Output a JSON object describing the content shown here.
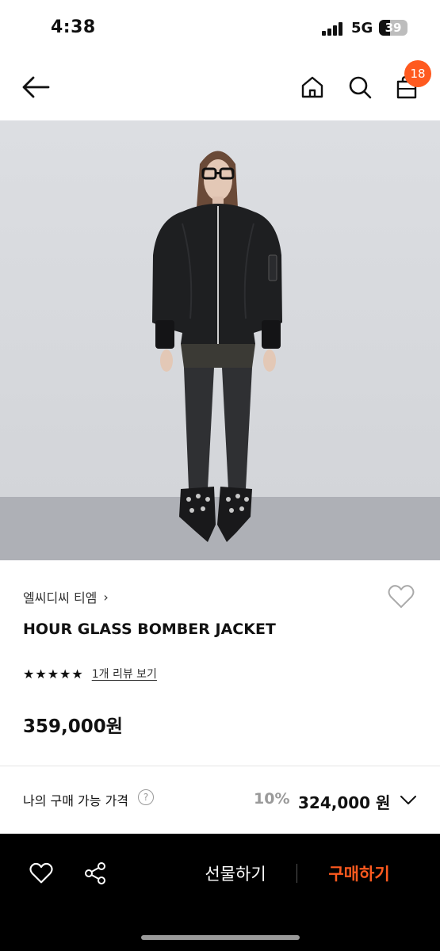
{
  "status_bar": {
    "time": "4:38",
    "network": "5G",
    "battery_level": "39"
  },
  "nav": {
    "back_icon": "arrow-left-icon",
    "home_icon": "home-icon",
    "search_icon": "search-icon",
    "cart_icon": "shopping-bag-icon",
    "cart_count": "18"
  },
  "product": {
    "brand": "엘씨디씨 티엠",
    "brand_chevron": "›",
    "name": "HOUR GLASS BOMBER JACKET",
    "rating_stars": "★★★★★",
    "rating": 5,
    "review_link": "1개 리뷰 보기",
    "price": "359,000원",
    "wishlist_icon": "heart-outline-icon"
  },
  "my_price": {
    "label": "나의 구매 가능 가격",
    "help_glyph": "?",
    "discount": "10%",
    "price": "324,000 원",
    "expand_icon": "chevron-down-icon"
  },
  "bottom_bar": {
    "gift_label": "선물하기",
    "buy_label": "구매하기",
    "wishlist_icon": "heart-outline-icon",
    "share_icon": "share-icon"
  },
  "colors": {
    "accent": "#ff5a1f",
    "bottom_bar_bg": "#000000",
    "muted_text": "#9a9a9a"
  }
}
